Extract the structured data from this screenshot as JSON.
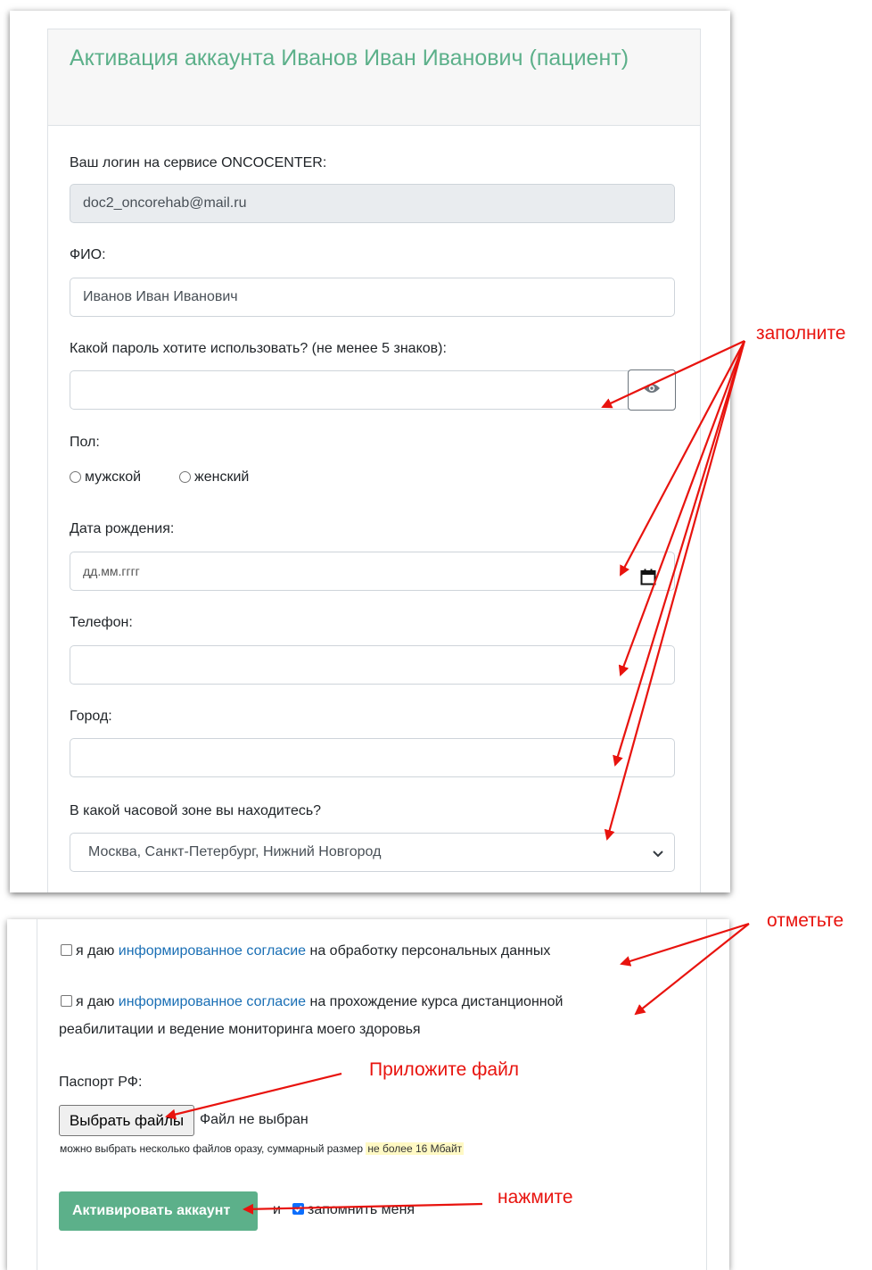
{
  "form": {
    "title": "Активация аккаунта Иванов Иван Иванович (пациент)",
    "login_label": "Ваш логин на сервисе ONCOCENTER:",
    "login_value": "doc2_oncorehab@mail.ru",
    "fio_label": "ФИО:",
    "fio_value": "Иванов Иван Иванович",
    "password_label": "Какой пароль хотите использовать? (не менее 5 знаков):",
    "password_value": "",
    "gender_label": "Пол:",
    "gender_options": [
      "мужской",
      "женский"
    ],
    "birthdate_label": "Дата рождения:",
    "birthdate_placeholder": "дд.мм.гггг",
    "phone_label": "Телефон:",
    "phone_value": "",
    "city_label": "Город:",
    "city_value": "",
    "timezone_label": "В какой часовой зоне вы находитесь?",
    "timezone_value": "Москва, Санкт-Петербург, Нижний Новгород"
  },
  "consent": {
    "prefix": "я даю",
    "link_text": "информированное согласие",
    "consent1_rest": "на обработку персональных данных",
    "consent2_rest": "на прохождение курса дистанционной",
    "consent2_line2": "реабилитации и ведение мониторинга моего здоровья"
  },
  "passport": {
    "label": "Паспорт РФ:",
    "choose_button": "Выбрать файлы",
    "no_file": "Файл не выбран",
    "hint_prefix": "можно выбрать несколько файлов оразу, суммарный размер",
    "hint_limit": "не более 16 Мбайт"
  },
  "submit": {
    "activate_button": "Активировать аккаунт",
    "and_text": "и",
    "remember_label": "запомнить меня",
    "remember_checked": true
  },
  "annotations": {
    "fill": "заполните",
    "check": "отметьте",
    "attach": "Приложите файл",
    "press": "нажмите",
    "color": "#e8130e"
  }
}
